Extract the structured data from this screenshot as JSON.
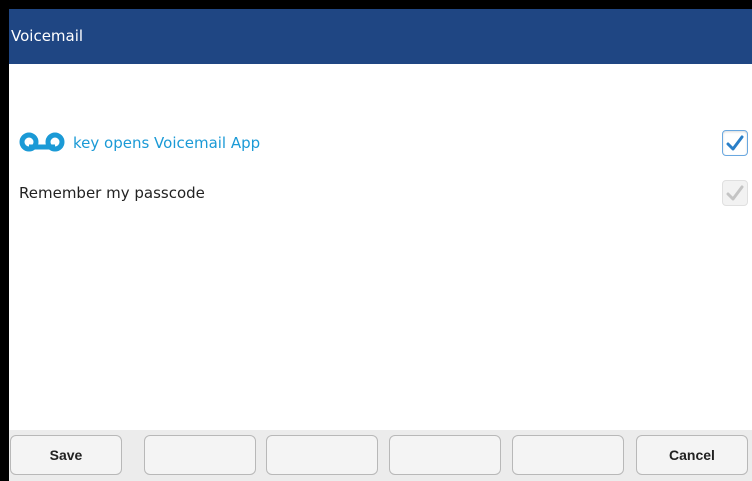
{
  "window": {
    "title": "Voicemail"
  },
  "settings": [
    {
      "label": "key opens Voicemail App",
      "icon": "voicemail-icon",
      "checked": true,
      "enabled": true
    },
    {
      "label": "Remember my passcode",
      "checked": true,
      "enabled": false
    }
  ],
  "softkeys": [
    {
      "label": "Save"
    },
    {
      "label": ""
    },
    {
      "label": ""
    },
    {
      "label": ""
    },
    {
      "label": ""
    },
    {
      "label": "Cancel"
    }
  ],
  "colors": {
    "titlebar": "#1f4683",
    "accent": "#1b9ad6",
    "checkmark": "#2a7fc8"
  }
}
